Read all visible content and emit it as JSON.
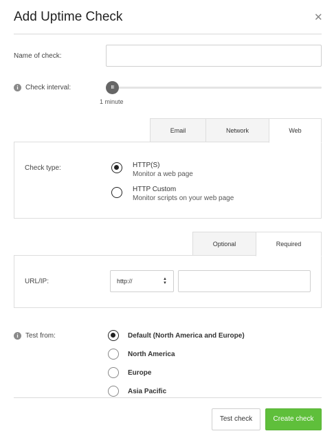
{
  "dialog": {
    "title": "Add Uptime Check",
    "close_glyph": "✕"
  },
  "name_field": {
    "label": "Name of check:",
    "value": "",
    "placeholder": ""
  },
  "interval": {
    "label": "Check interval:",
    "thumb_glyph": "III",
    "value_text": "1 minute",
    "slider_fraction": 0.0
  },
  "check_tabs": [
    "Email",
    "Network",
    "Web"
  ],
  "check_tabs_active": "Web",
  "check_type": {
    "label": "Check type:",
    "options": [
      {
        "title": "HTTP(S)",
        "subtitle": "Monitor a web page",
        "selected": true
      },
      {
        "title": "HTTP Custom",
        "subtitle": "Monitor scripts on your web page",
        "selected": false
      }
    ]
  },
  "url_tabs": [
    "Optional",
    "Required"
  ],
  "url_tabs_active": "Required",
  "url": {
    "label": "URL/IP:",
    "protocol": "http://",
    "value": ""
  },
  "test_from": {
    "label": "Test from:",
    "options": [
      {
        "label": "Default (North America and Europe)",
        "selected": true
      },
      {
        "label": "North America",
        "selected": false
      },
      {
        "label": "Europe",
        "selected": false
      },
      {
        "label": "Asia Pacific",
        "selected": false
      }
    ]
  },
  "footer": {
    "test_label": "Test check",
    "create_label": "Create check"
  },
  "colors": {
    "primary_green": "#5fbf3b",
    "border": "#dddddd"
  }
}
